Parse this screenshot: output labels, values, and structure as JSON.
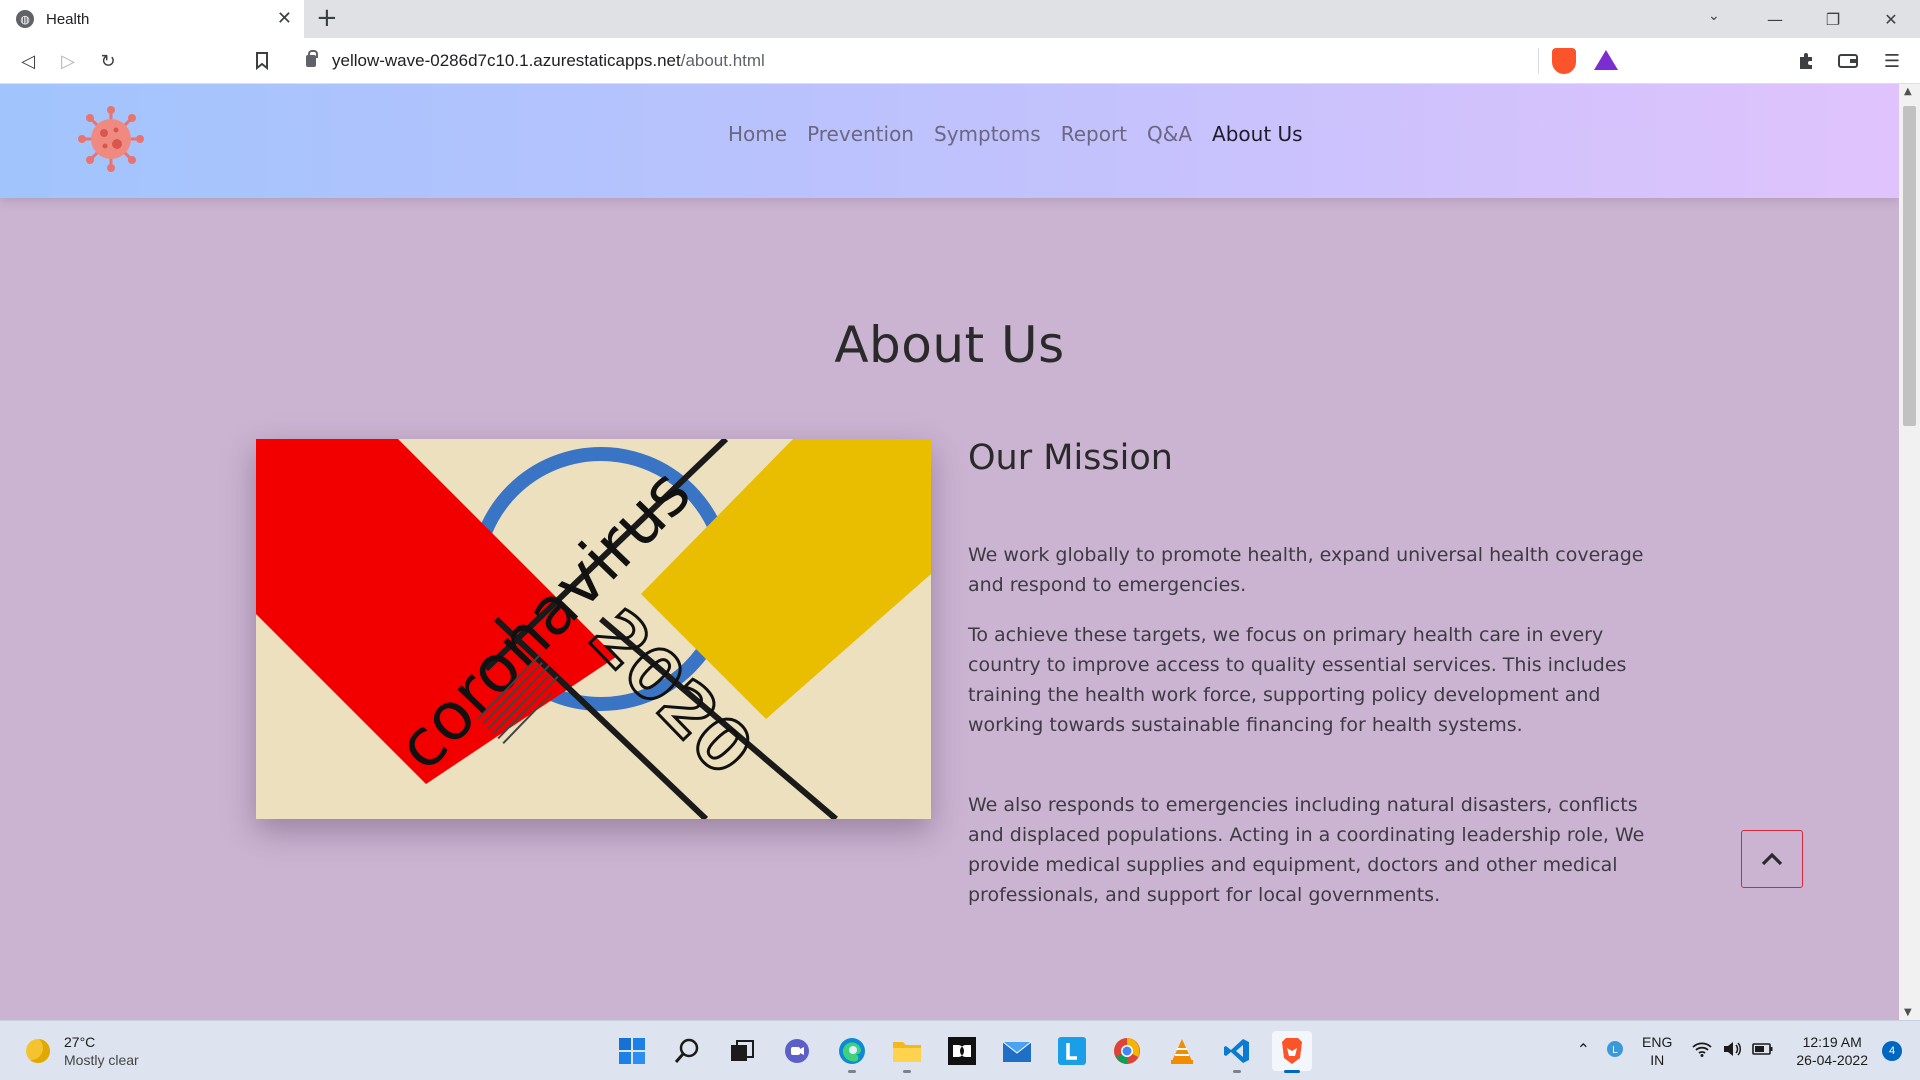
{
  "browser": {
    "tab_title": "Health",
    "url_host": "yellow-wave-0286d7c10.1.azurestaticapps.net",
    "url_path": "/about.html"
  },
  "site": {
    "nav": [
      "Home",
      "Prevention",
      "Symptoms",
      "Report",
      "Q&A",
      "About Us"
    ],
    "active_nav": "About Us",
    "page_title": "About Us",
    "hero_image": {
      "word": "coronavirus",
      "year": "2020"
    },
    "mission": {
      "title": "Our Mission",
      "paragraphs": [
        "We work globally to promote health, expand universal health coverage and respond to emergencies.",
        "To achieve these targets, we focus on primary health care in every country to improve access to quality essential services. This includes training the health work force, supporting policy development and working towards sustainable financing for health systems.",
        "We also responds to emergencies including natural disasters, conflicts and displaced populations. Acting in a coordinating leadership role, We provide medical supplies and equipment, doctors and other medical professionals, and support for local governments."
      ]
    },
    "back_to_top_icon": "chevron-up-icon"
  },
  "taskbar": {
    "weather_temp": "27°C",
    "weather_desc": "Mostly clear",
    "lang_top": "ENG",
    "lang_bottom": "IN",
    "time": "12:19 AM",
    "date": "26-04-2022",
    "notifications": "4"
  },
  "colors": {
    "header_gradient_start": "#a1c4fd",
    "header_gradient_end": "#e0c3fc",
    "page_bg": "#cbb3d2",
    "accent_red": "#f20000",
    "accent_yellow": "#e9bd00",
    "accent_blue": "#3a74c4"
  }
}
